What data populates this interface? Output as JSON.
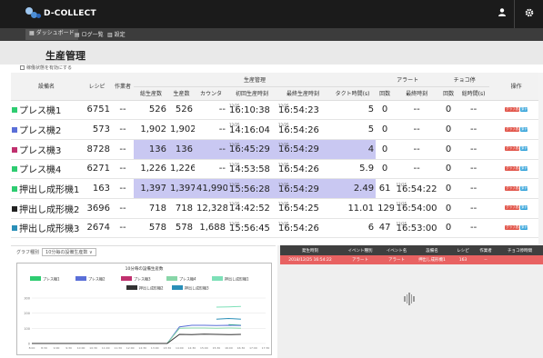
{
  "app": {
    "name": "D-COLLECT"
  },
  "topbar": {
    "user_icon": "person-icon",
    "settings_icon": "gear-icon"
  },
  "nav": [
    {
      "icon": "dashboard-icon",
      "label": "ダッシュボード",
      "active": true
    },
    {
      "icon": "document-icon",
      "label": "ログ一覧",
      "active": false
    },
    {
      "icon": "bar-chart-icon",
      "label": "設定",
      "active": false
    }
  ],
  "page": {
    "title": "生産管理",
    "option_label": "稼働状態を有効にする"
  },
  "table": {
    "group_headers": {
      "production": "生産管理",
      "alert": "アラート",
      "stop": "チョコ停"
    },
    "headers": {
      "equipment": "設備名",
      "recipe": "レシピ",
      "worker": "作業者",
      "total": "総生産数",
      "produced": "生産数",
      "counter": "カウンタ",
      "first_time": "初回生産時刻",
      "last_time": "最終生産時刻",
      "takt": "タクト時間(s)",
      "alert_count": "回数",
      "alert_last": "最終時刻",
      "stop_count": "回数",
      "stop_total": "総時間(s)",
      "operation": "操作"
    },
    "rows": [
      {
        "color": "#2ecc71",
        "name": "プレス機1",
        "recipe": "6751",
        "worker": "--",
        "total": "526",
        "produced": "526",
        "counter": "--",
        "first_date": "12/25",
        "first_time": "16:10:38",
        "last_date": "12/25",
        "last_time": "16:54:23",
        "takt": "5",
        "alert_count": "0",
        "alert_last_date": "",
        "alert_last": "--",
        "stop_count": "0",
        "stop_total": "--",
        "highlight": false
      },
      {
        "color": "#5a6fd8",
        "name": "プレス機2",
        "recipe": "573",
        "worker": "--",
        "total": "1,902",
        "produced": "1,902",
        "counter": "--",
        "first_date": "12/25",
        "first_time": "14:16:04",
        "last_date": "12/25",
        "last_time": "16:54:26",
        "takt": "5",
        "alert_count": "0",
        "alert_last_date": "",
        "alert_last": "--",
        "stop_count": "0",
        "stop_total": "--",
        "highlight": false
      },
      {
        "color": "#c0306e",
        "name": "プレス機3",
        "recipe": "8728",
        "worker": "--",
        "total": "136",
        "produced": "136",
        "counter": "--",
        "first_date": "12/25",
        "first_time": "16:45:29",
        "last_date": "12/25",
        "last_time": "16:54:29",
        "takt": "4",
        "alert_count": "0",
        "alert_last_date": "",
        "alert_last": "--",
        "stop_count": "0",
        "stop_total": "--",
        "highlight": true
      },
      {
        "color": "#2ecc71",
        "name": "プレス機4",
        "recipe": "6271",
        "worker": "--",
        "total": "1,226",
        "produced": "1,226",
        "counter": "--",
        "first_date": "12/25",
        "first_time": "14:53:58",
        "last_date": "12/25",
        "last_time": "16:54:26",
        "takt": "5.9",
        "alert_count": "0",
        "alert_last_date": "",
        "alert_last": "--",
        "stop_count": "0",
        "stop_total": "--",
        "highlight": false
      },
      {
        "color": "#2ecc71",
        "name": "押出し成形機1",
        "recipe": "163",
        "worker": "--",
        "total": "1,397",
        "produced": "1,397",
        "counter": "41,990",
        "first_date": "12/25",
        "first_time": "15:56:28",
        "last_date": "12/25",
        "last_time": "16:54:29",
        "takt": "2.49",
        "alert_count": "61",
        "alert_last_date": "12/25",
        "alert_last": "16:54:22",
        "stop_count": "0",
        "stop_total": "--",
        "highlight": true
      },
      {
        "color": "#222222",
        "name": "押出し成形機2",
        "recipe": "3696",
        "worker": "--",
        "total": "718",
        "produced": "718",
        "counter": "12,328",
        "first_date": "12/25",
        "first_time": "14:42:52",
        "last_date": "12/25",
        "last_time": "16:54:25",
        "takt": "11.01",
        "alert_count": "129",
        "alert_last_date": "12/25",
        "alert_last": "16:54:00",
        "stop_count": "0",
        "stop_total": "--",
        "highlight": false
      },
      {
        "color": "#2a8fb8",
        "name": "押出し成形機3",
        "recipe": "2674",
        "worker": "--",
        "total": "578",
        "produced": "578",
        "counter": "1,688",
        "first_date": "12/25",
        "first_time": "15:56:45",
        "last_date": "12/25",
        "last_time": "16:54:26",
        "takt": "6",
        "alert_count": "47",
        "alert_last_date": "12/25",
        "alert_last": "16:53:00",
        "stop_count": "0",
        "stop_total": "--",
        "highlight": false
      }
    ],
    "op_graph": "グラフ表示",
    "op_detail": "集計"
  },
  "chart_panel": {
    "type_label": "グラフ種別",
    "select_value": "10分毎の設備生産数",
    "select_icon": "chevron-down-icon"
  },
  "chart_data": {
    "type": "line",
    "title": "10分毎の設備生産数",
    "xlabel": "",
    "ylabel": "",
    "legend_position": "top",
    "grid": true,
    "x": [
      "8:00",
      "8:30",
      "9:00",
      "9:30",
      "10:00",
      "10:30",
      "11:00",
      "11:30",
      "12:00",
      "12:30",
      "13:00",
      "13:30",
      "14:00",
      "14:30",
      "15:00",
      "15:30",
      "16:00",
      "16:30",
      "17:00",
      "17:30"
    ],
    "ylim": [
      0,
      300
    ],
    "series": [
      {
        "name": "プレス機1",
        "color": "#2ecc71",
        "values": [
          null,
          null,
          null,
          null,
          null,
          null,
          null,
          null,
          null,
          null,
          null,
          null,
          null,
          null,
          null,
          null,
          124,
          120,
          null,
          null
        ]
      },
      {
        "name": "プレス機2",
        "color": "#5a6fd8",
        "values": [
          0,
          0,
          0,
          0,
          0,
          0,
          0,
          0,
          0,
          0,
          0,
          0,
          110,
          120,
          120,
          118,
          120,
          118,
          null,
          null
        ]
      },
      {
        "name": "プレス機3",
        "color": "#c0306e",
        "values": [
          null,
          null,
          null,
          null,
          null,
          null,
          null,
          null,
          null,
          null,
          null,
          null,
          null,
          null,
          null,
          null,
          null,
          140,
          null,
          null
        ]
      },
      {
        "name": "プレス機4",
        "color": "#88d6a8",
        "values": [
          0,
          0,
          0,
          0,
          0,
          0,
          0,
          0,
          0,
          0,
          0,
          0,
          100,
          102,
          102,
          100,
          102,
          101,
          null,
          null
        ]
      },
      {
        "name": "押出し成形機1",
        "color": "#7de0b8",
        "values": [
          null,
          null,
          null,
          null,
          null,
          null,
          null,
          null,
          null,
          null,
          null,
          null,
          null,
          null,
          null,
          240,
          242,
          244,
          null,
          null
        ]
      },
      {
        "name": "押出し成形機2",
        "color": "#333333",
        "values": [
          0,
          0,
          0,
          0,
          0,
          0,
          0,
          0,
          0,
          0,
          0,
          0,
          60,
          58,
          62,
          60,
          58,
          60,
          null,
          null
        ]
      },
      {
        "name": "押出し成形機3",
        "color": "#2a8fb8",
        "values": [
          null,
          null,
          null,
          null,
          null,
          null,
          null,
          null,
          null,
          null,
          null,
          null,
          null,
          null,
          null,
          160,
          165,
          160,
          null,
          null
        ]
      }
    ]
  },
  "events": {
    "headers": [
      "発生時刻",
      "イベント種別",
      "イベント名",
      "設備名",
      "レシピ",
      "作業者",
      "チョコ停時間"
    ],
    "rows": [
      [
        "2018/12/25 16:54:22",
        "アラート",
        "アラート",
        "押出し成形機1",
        "163",
        "--",
        ""
      ]
    ]
  }
}
